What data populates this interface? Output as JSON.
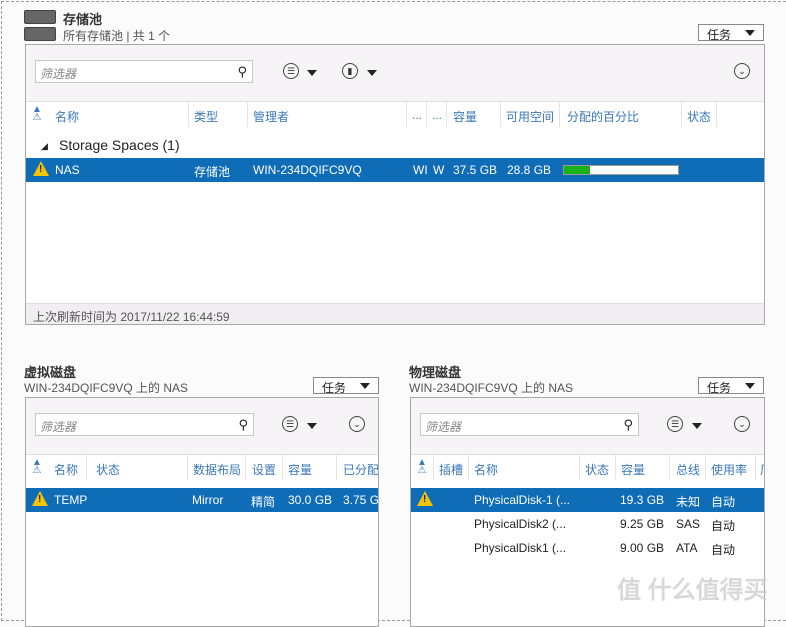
{
  "colors": {
    "accent": "#0f6cb7",
    "header_text": "#3b78b8",
    "progress": "#17b21a",
    "warning": "#f5c400"
  },
  "storage_pools": {
    "title": "存储池",
    "subtitle": "所有存储池 | 共 1 个",
    "tasks_label": "任务",
    "filter_placeholder": "筛选器",
    "columns": [
      "名称",
      "类型",
      "管理者",
      "...",
      "...",
      "容量",
      "可用空间",
      "分配的百分比",
      "状态"
    ],
    "group_label": "Storage Spaces (1)",
    "rows": [
      {
        "name": "NAS",
        "type": "存储池",
        "manager": "WIN-234DQIFC9VQ",
        "c1": "WI",
        "c2": "W",
        "capacity": "37.5 GB",
        "free": "28.8 GB",
        "allocated_percent": 23,
        "status": "warning"
      }
    ],
    "footer": "上次刷新时间为 2017/11/22 16:44:59"
  },
  "virtual_disks": {
    "title": "虚拟磁盘",
    "subtitle": "WIN-234DQIFC9VQ 上的 NAS",
    "tasks_label": "任务",
    "filter_placeholder": "筛选器",
    "columns": [
      "名称",
      "状态",
      "数据布局",
      "设置",
      "容量",
      "已分配"
    ],
    "rows": [
      {
        "name": "TEMP",
        "status": "",
        "layout": "Mirror",
        "provisioning": "精简",
        "capacity": "30.0 GB",
        "allocated": "3.75 G"
      }
    ]
  },
  "physical_disks": {
    "title": "物理磁盘",
    "subtitle": "WIN-234DQIFC9VQ 上的 NAS",
    "tasks_label": "任务",
    "filter_placeholder": "筛选器",
    "columns": [
      "插槽",
      "名称",
      "状态",
      "容量",
      "总线",
      "使用率",
      "厂"
    ],
    "rows": [
      {
        "name": "PhysicalDisk-1 (...",
        "capacity": "19.3 GB",
        "bus": "未知",
        "usage": "自动",
        "warning": true
      },
      {
        "name": "PhysicalDisk2 (...",
        "capacity": "9.25 GB",
        "bus": "SAS",
        "usage": "自动",
        "warning": false
      },
      {
        "name": "PhysicalDisk1 (...",
        "capacity": "9.00 GB",
        "bus": "ATA",
        "usage": "自动",
        "warning": false
      }
    ]
  },
  "watermark": "值 什么值得买"
}
